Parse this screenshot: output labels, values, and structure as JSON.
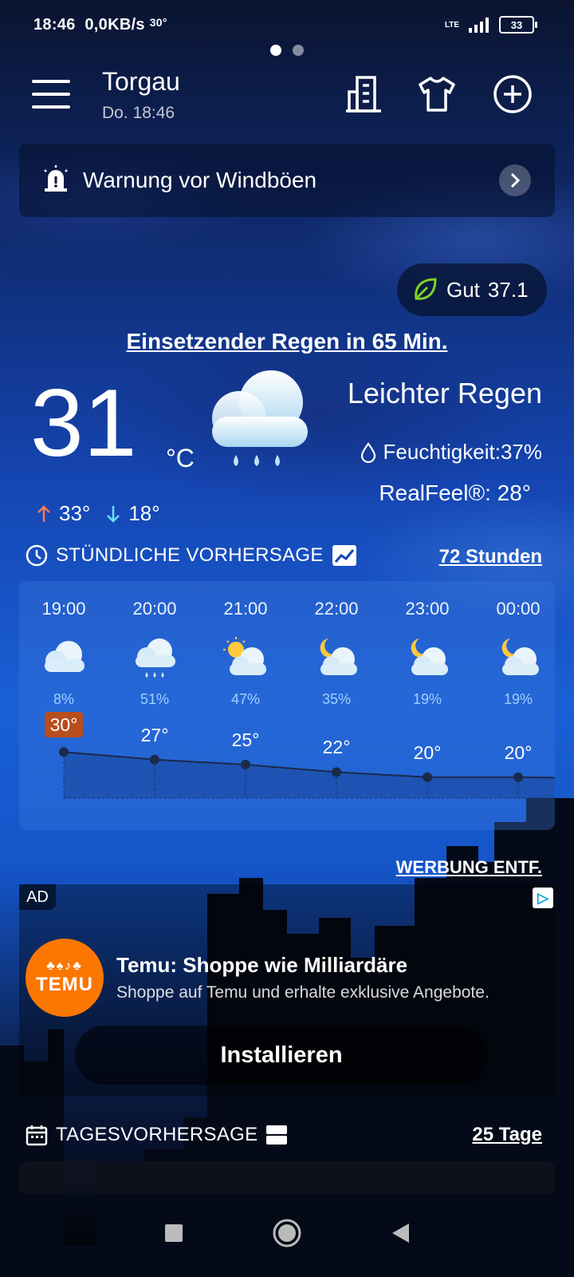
{
  "status_bar": {
    "time": "18:46",
    "speed": "0,0KB/s",
    "temp": "30°",
    "network": "LTE",
    "battery": "33"
  },
  "header": {
    "city": "Torgau",
    "datetime": "Do. 18:46"
  },
  "warning": {
    "text": "Warnung vor Windböen"
  },
  "aqi": {
    "label": "Gut",
    "value": "37.1"
  },
  "current": {
    "rain_notice": "Einsetzender Regen in 65 Min.",
    "temperature": "31",
    "unit": "°C",
    "condition": "Leichter Regen",
    "humidity": "Feuchtigkeit:37%",
    "realfeel": "RealFeel®: 28°",
    "high": "33°",
    "low": "18°"
  },
  "hourly": {
    "title": "STÜNDLICHE VORHERSAGE",
    "link": "72 Stunden",
    "items": [
      {
        "time": "19:00",
        "icon": "cloud-icon",
        "precip": "8%",
        "temp": "30°",
        "value": 30
      },
      {
        "time": "20:00",
        "icon": "rain-icon",
        "precip": "51%",
        "temp": "27°",
        "value": 27
      },
      {
        "time": "21:00",
        "icon": "partly-sunny-icon",
        "precip": "47%",
        "temp": "25°",
        "value": 25
      },
      {
        "time": "22:00",
        "icon": "moon-cloud-icon",
        "precip": "35%",
        "temp": "22°",
        "value": 22
      },
      {
        "time": "23:00",
        "icon": "moon-cloud-icon",
        "precip": "19%",
        "temp": "20°",
        "value": 20
      },
      {
        "time": "00:00",
        "icon": "moon-cloud-icon",
        "precip": "19%",
        "temp": "20°",
        "value": 20
      }
    ]
  },
  "ad": {
    "remove_label": "WERBUNG ENTF.",
    "badge": "AD",
    "brand": "TEMU",
    "title": "Temu: Shoppe wie Milliardäre",
    "subtitle": "Shoppe auf Temu und erhalte exklusive Angebote.",
    "cta": "Installieren"
  },
  "daily": {
    "title": "TAGESVORHERSAGE",
    "link": "25 Tage"
  }
}
